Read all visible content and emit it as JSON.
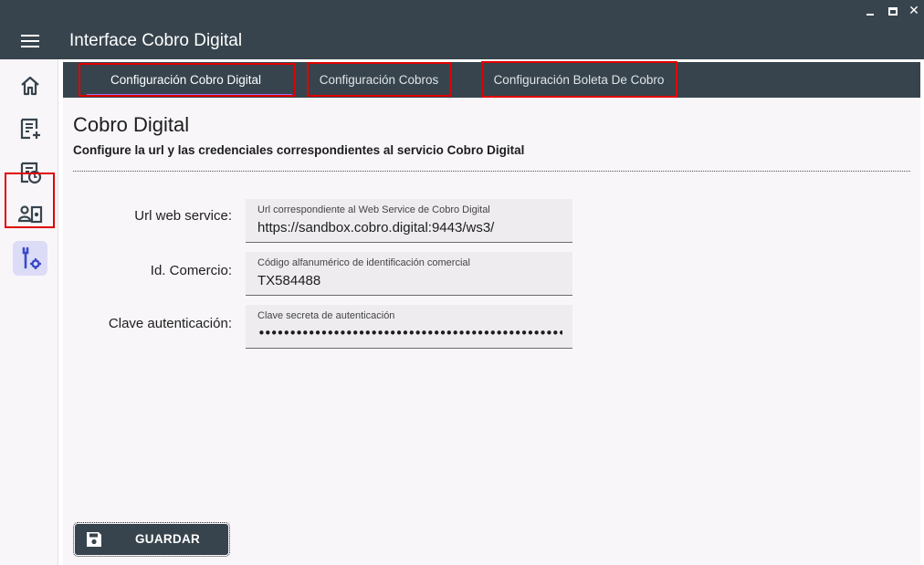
{
  "window": {
    "close_glyph": "✕"
  },
  "appbar": {
    "title": "Interface Cobro Digital"
  },
  "sidebar": {
    "items": [
      {
        "icon": "home-icon"
      },
      {
        "icon": "receipt-add-icon"
      },
      {
        "icon": "receipt-clock-icon"
      },
      {
        "icon": "user-cash-icon"
      },
      {
        "icon": "tools-settings-icon",
        "active": true
      }
    ]
  },
  "tabs": [
    {
      "label": "Configuración Cobro Digital",
      "active": true
    },
    {
      "label": "Configuración Cobros"
    },
    {
      "label": "Configuración Boleta De Cobro"
    }
  ],
  "section": {
    "title": "Cobro Digital",
    "subtitle": "Configure la url y las credenciales correspondientes al servicio Cobro Digital"
  },
  "form": {
    "url": {
      "label": "Url web service:",
      "hint": "Url correspondiente al Web Service de Cobro Digital",
      "value": "https://sandbox.cobro.digital:9443/ws3/"
    },
    "comercio": {
      "label": "Id. Comercio:",
      "hint": "Código alfanumérico de identificación comercial",
      "value": "TX584488"
    },
    "clave": {
      "label": "Clave autenticación:",
      "hint": "Clave secreta de autenticación",
      "value": "••••••••••••••••••••••••••••••••••••••••••••••••••••••••••••••"
    }
  },
  "actions": {
    "save_label": "GUARDAR"
  },
  "colors": {
    "primary": "#37444d",
    "highlight": "#e00000",
    "tab_indicator": "#8a7cf0",
    "nav_active": "#dcdcf7"
  }
}
